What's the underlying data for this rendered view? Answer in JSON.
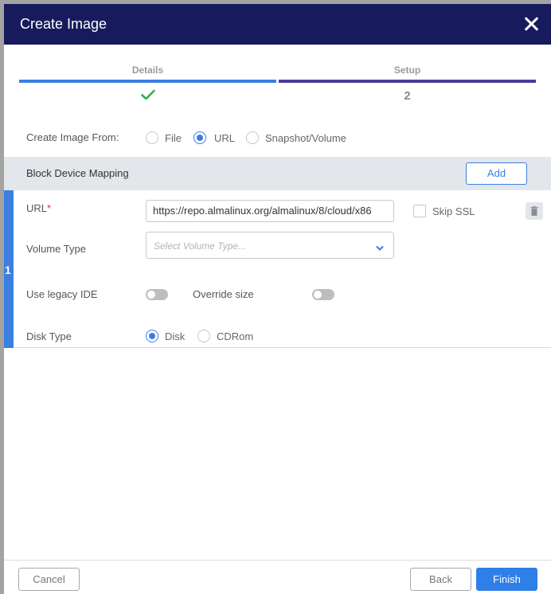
{
  "dialog": {
    "title": "Create Image",
    "close_icon": "close-icon"
  },
  "steps": [
    {
      "label": "Details",
      "status": "complete",
      "icon": "checkmark-icon",
      "bar_color": "#3a7fe2"
    },
    {
      "label": "Setup",
      "number": "2",
      "bar_color": "#4b3a97"
    }
  ],
  "create_from": {
    "label": "Create Image From:",
    "options": [
      "File",
      "URL",
      "Snapshot/Volume"
    ],
    "selected": "URL"
  },
  "block_device_mapping": {
    "title": "Block Device Mapping",
    "add_label": "Add",
    "entries": [
      {
        "index": "1",
        "url_label": "URL",
        "required_mark": "*",
        "url_value": "https://repo.almalinux.org/almalinux/8/cloud/x86",
        "skip_ssl_label": "Skip SSL",
        "skip_ssl_checked": false,
        "volume_type_label": "Volume Type",
        "volume_type_placeholder": "Select Volume Type...",
        "legacy_ide_label": "Use legacy IDE",
        "legacy_ide_on": false,
        "override_size_label": "Override size",
        "override_size_on": false,
        "disk_type_label": "Disk Type",
        "disk_type_options": [
          "Disk",
          "CDRom"
        ],
        "disk_type_selected": "Disk",
        "delete_icon": "trash-icon"
      }
    ]
  },
  "footer": {
    "cancel_label": "Cancel",
    "back_label": "Back",
    "finish_label": "Finish"
  },
  "colors": {
    "header_bg": "#171a5c",
    "accent": "#3a7fe2",
    "primary_button": "#2f7fe8",
    "success": "#28b44a",
    "required": "#e0332f"
  }
}
